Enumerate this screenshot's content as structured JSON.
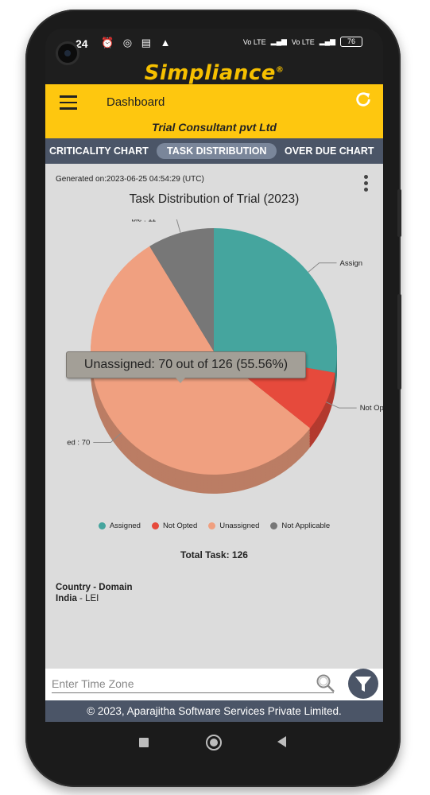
{
  "status_bar": {
    "time": "24",
    "left_icons": "⏰ ◎ ▤ ▲",
    "net1": "Vo LTE",
    "net2": "Vo LTE",
    "battery": "76"
  },
  "brand": {
    "name": "Simpliance",
    "mark": "®"
  },
  "app_bar": {
    "title": "Dashboard",
    "company": "Trial Consultant pvt Ltd"
  },
  "tabs": [
    {
      "label": "CRITICALITY CHART",
      "active": false
    },
    {
      "label": "TASK DISTRIBUTION",
      "active": true
    },
    {
      "label": "OVER DUE CHART",
      "active": false
    }
  ],
  "report": {
    "generated": "Generated on:2023-06-25 04:54:29 (UTC)",
    "title": "Task Distribution of Trial (2023)",
    "total": "Total Task: 126"
  },
  "chart_data": {
    "type": "pie",
    "title": "Task Distribution of Trial (2023)",
    "total": 126,
    "slices": [
      {
        "name": "Assigned",
        "value": 35,
        "color": "#45a59e"
      },
      {
        "name": "Not Opted",
        "value": 10,
        "color": "#e64a3c"
      },
      {
        "name": "Unassigned",
        "value": 70,
        "color": "#f0a080"
      },
      {
        "name": "Not Applicable",
        "value": 11,
        "color": "#777777"
      }
    ],
    "data_labels": [
      "Assign",
      "Not Op",
      "ed : 70",
      "ble : 11"
    ],
    "tooltip": "Unassigned: 70 out of 126 (55.56%)",
    "legend_placement": "bottom"
  },
  "country": {
    "heading": "Country - Domain",
    "country": "India",
    "domain": "- LEI"
  },
  "search": {
    "placeholder": "Enter Time Zone"
  },
  "footer": "© 2023, Aparajitha Software Services Private Limited."
}
